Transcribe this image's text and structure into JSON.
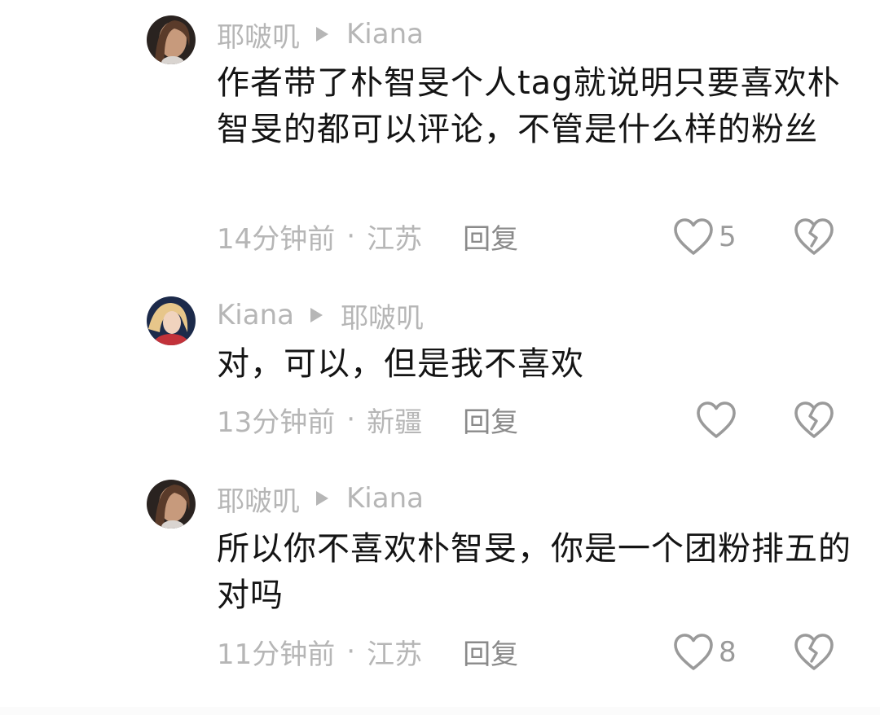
{
  "comments": [
    {
      "author": "耶啵叽",
      "reply_to": "Kiana",
      "text": "作者带了朴智旻个人tag就说明只要喜欢朴智旻的都可以评论，不管是什么样的粉丝",
      "time": "14分钟前",
      "location": "江苏",
      "reply_label": "回复",
      "likes": "5",
      "avatar": "avatar-brown-hair"
    },
    {
      "author": "Kiana",
      "reply_to": "耶啵叽",
      "text": "对，可以，但是我不喜欢",
      "time": "13分钟前",
      "location": "新疆",
      "reply_label": "回复",
      "likes": "",
      "avatar": "avatar-blonde-hair"
    },
    {
      "author": "耶啵叽",
      "reply_to": "Kiana",
      "text": "所以你不喜欢朴智旻，你是一个团粉排五的对吗",
      "time": "11分钟前",
      "location": "江苏",
      "reply_label": "回复",
      "likes": "8",
      "avatar": "avatar-brown-hair"
    }
  ],
  "separator": "·",
  "icons": {
    "like": "heart-outline-icon",
    "dislike": "broken-heart-icon",
    "reply_arrow": "play-arrow-icon"
  },
  "colors": {
    "meta_gray": "#b6b6b6",
    "text": "#141414",
    "icon_gray": "#9a9a9a"
  }
}
